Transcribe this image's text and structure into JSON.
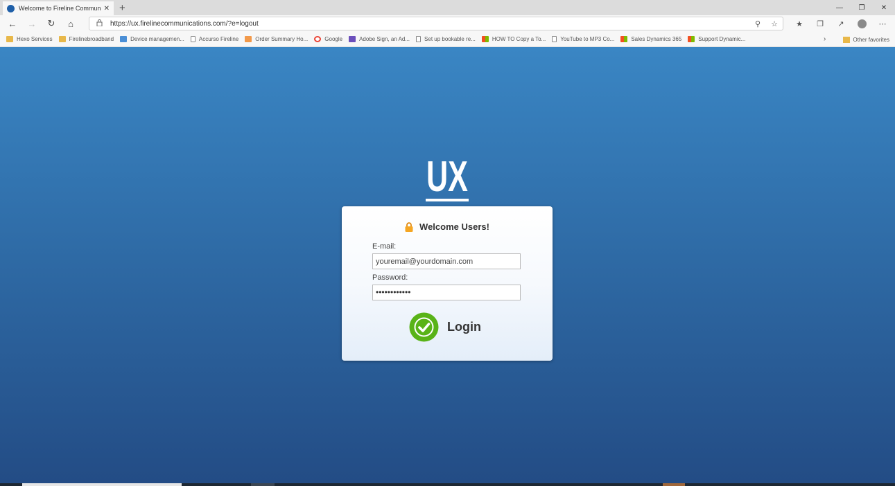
{
  "browser": {
    "tab_title": "Welcome to Fireline Communica",
    "tab_close": "✕",
    "new_tab": "+",
    "window_controls": [
      "—",
      "❐",
      "✕"
    ],
    "url": "https://ux.firelinecommunications.com/?e=logout",
    "favorites": [
      {
        "label": "Hexo Services",
        "icon": "folder-icon"
      },
      {
        "label": "Firelinebroadband",
        "icon": "folder-icon"
      },
      {
        "label": "Device managemen...",
        "icon": "device-icon"
      },
      {
        "label": "Accurso Fireline",
        "icon": "page-icon"
      },
      {
        "label": "Order Summary Ho...",
        "icon": "order-icon"
      },
      {
        "label": "Google",
        "icon": "google-icon"
      },
      {
        "label": "Adobe Sign, an Ad...",
        "icon": "adobe-icon"
      },
      {
        "label": "Set up bookable re...",
        "icon": "page-icon"
      },
      {
        "label": "HOW TO Copy a To...",
        "icon": "ms-icon"
      },
      {
        "label": "YouTube to MP3 Co...",
        "icon": "page-icon"
      },
      {
        "label": "Sales Dynamics 365",
        "icon": "ms-icon"
      },
      {
        "label": "Support Dynamic...",
        "icon": "ms-icon"
      }
    ],
    "other_favorites": "Other favorites"
  },
  "login": {
    "logo_text": "UX",
    "welcome": "Welcome Users!",
    "email_label": "E-mail:",
    "email_placeholder": "youremail@yourdomain.com",
    "password_label": "Password:",
    "password_value": "••••••••••••",
    "login_label": "Login"
  },
  "colors": {
    "background_top": "#3a86c4",
    "background_bottom": "#234c85",
    "lock_orange": "#f5a623",
    "check_green": "#59b318"
  }
}
